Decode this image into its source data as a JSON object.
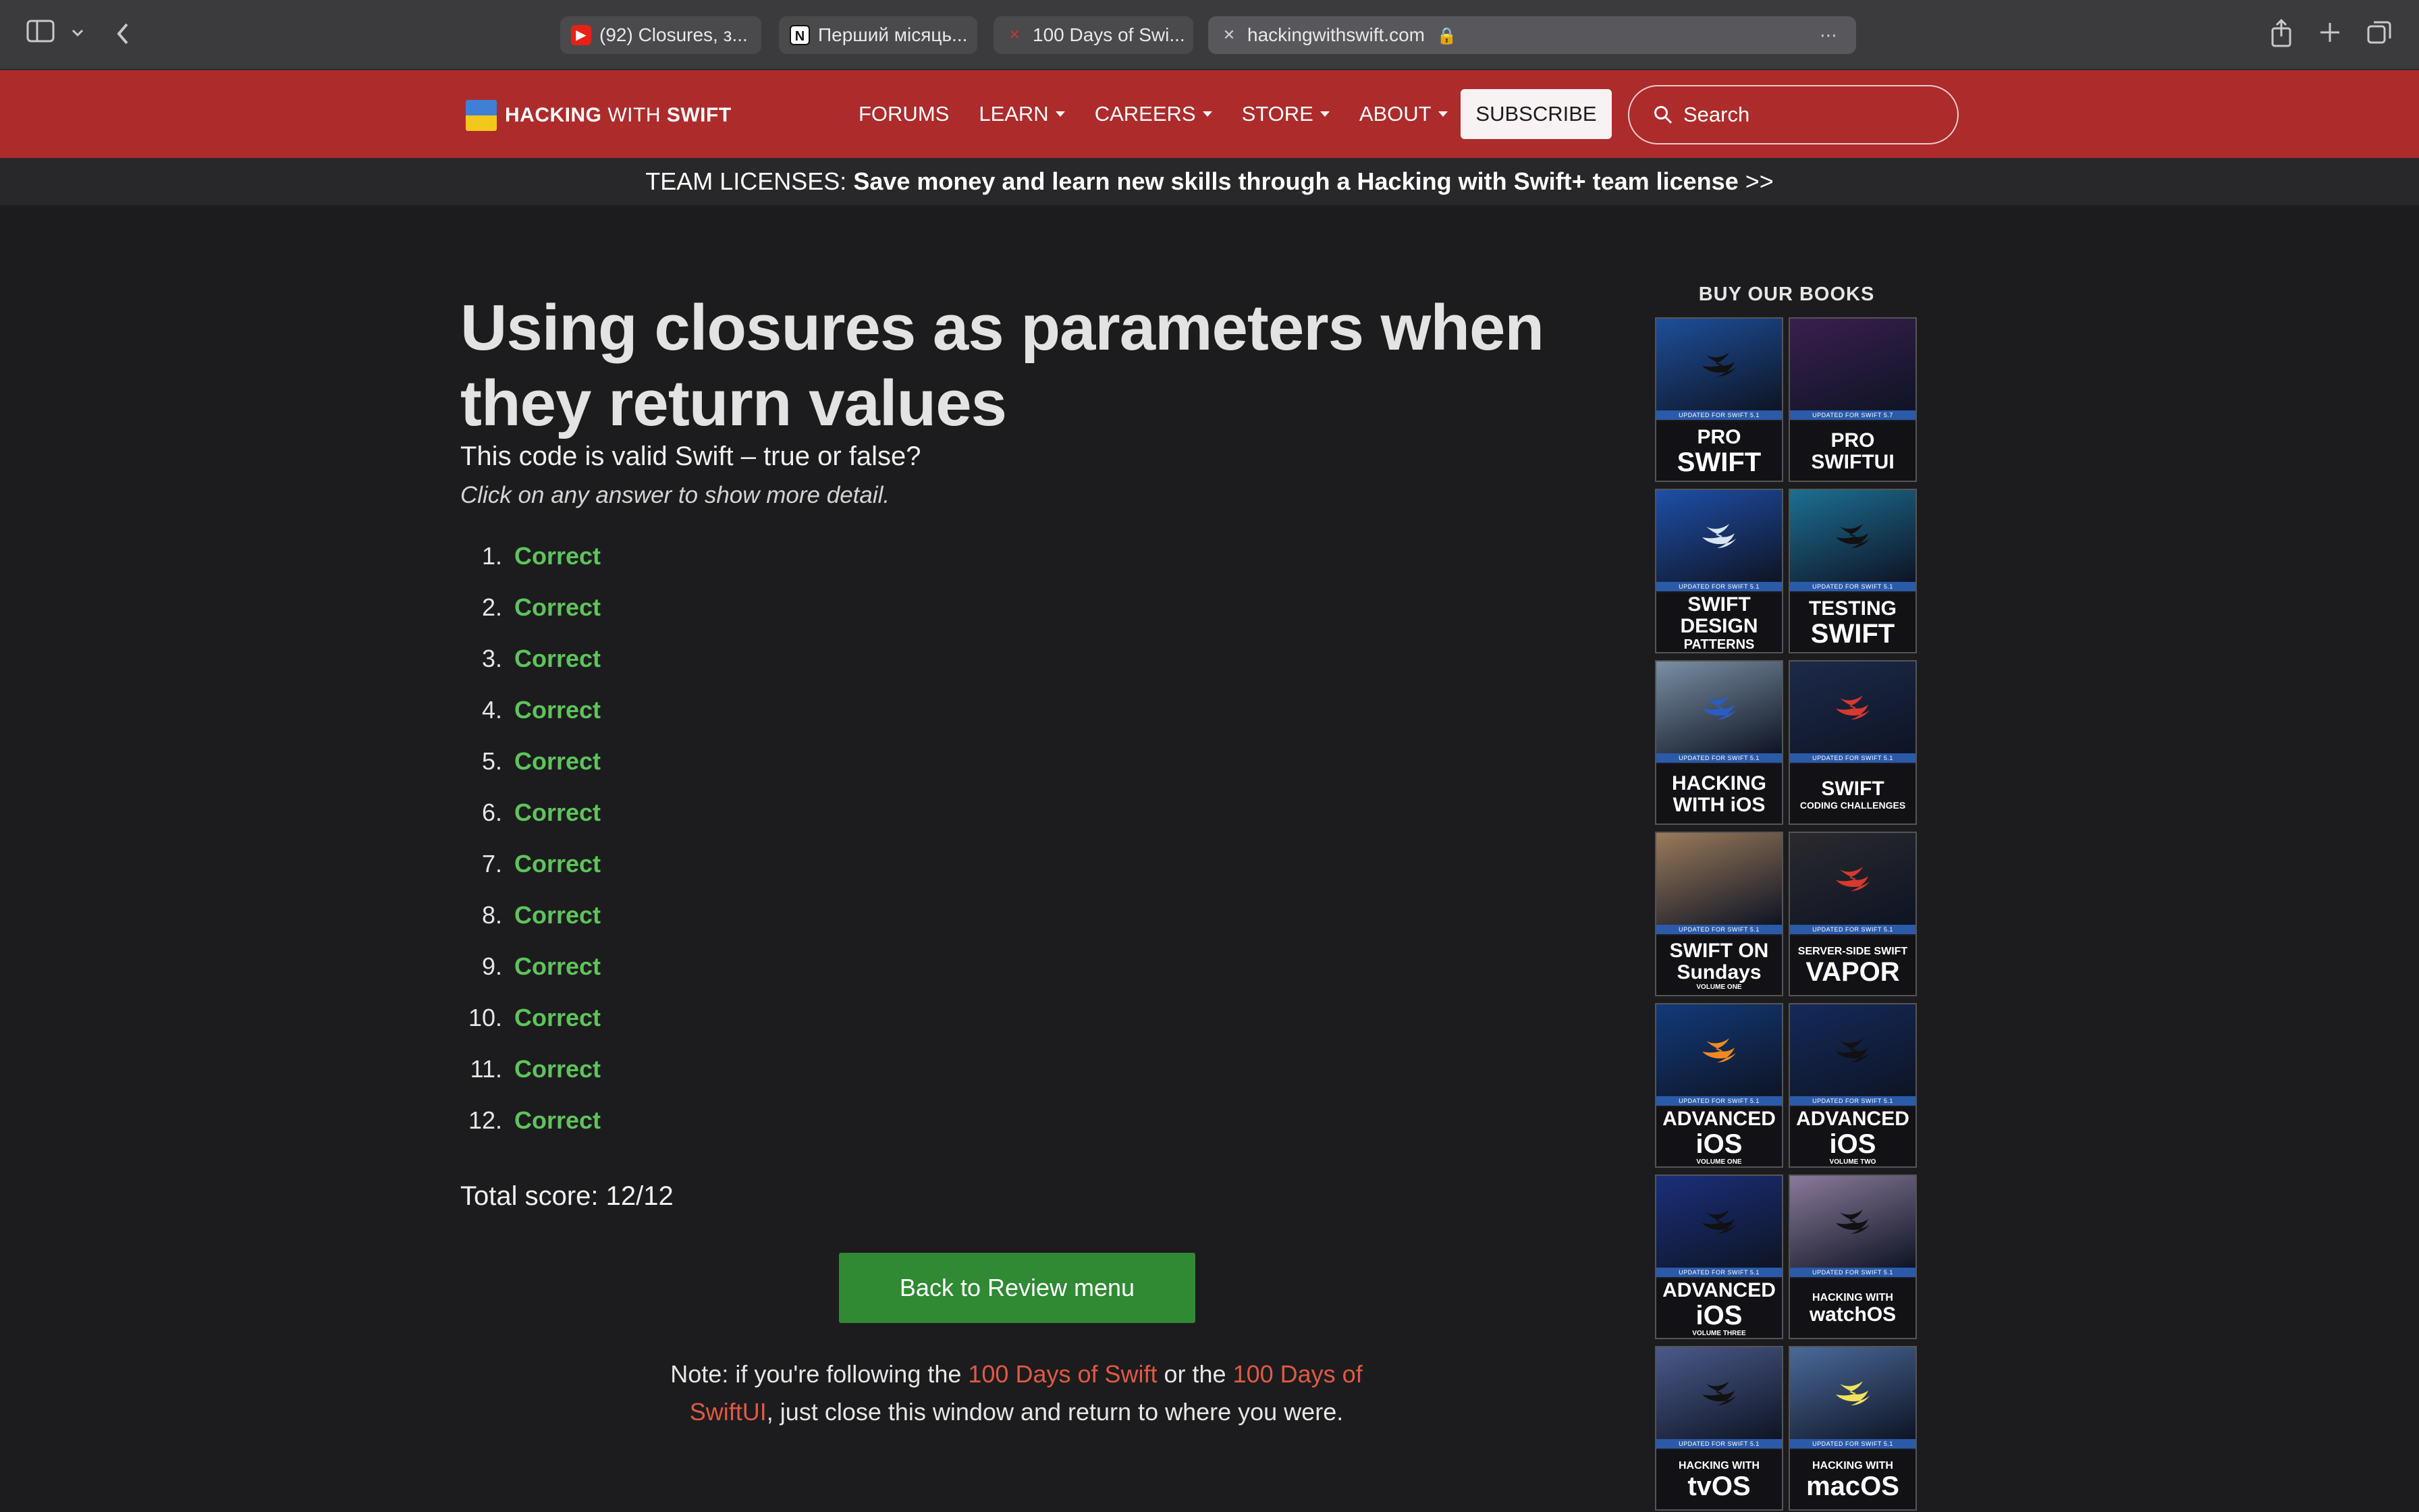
{
  "browser": {
    "tabs": [
      {
        "label": "(92) Closures, з...",
        "favicon": "youtube-icon",
        "color": "#e62117"
      },
      {
        "label": "Перший місяць...",
        "favicon": "notion-icon",
        "color": "#ffffff"
      },
      {
        "label": "100 Days of Swi...",
        "favicon": "swift-icon",
        "color": "#c0392b"
      }
    ],
    "address": "hackingwithswift.com"
  },
  "nav": {
    "logo_bold": "HACKING",
    "logo_with": "WITH",
    "logo_swift": "SWIFT",
    "links": [
      "FORUMS",
      "LEARN",
      "CAREERS",
      "STORE",
      "ABOUT"
    ],
    "subscribe": "SUBSCRIBE",
    "search_placeholder": "Search"
  },
  "banner": {
    "prefix": "TEAM LICENSES:",
    "text": "Save money and learn new skills through a Hacking with Swift+ team license",
    "suffix": ">>"
  },
  "main": {
    "title": "Using closures as parameters when they return values",
    "subtitle": "This code is valid Swift – true or false?",
    "hint": "Click on any answer to show more detail.",
    "answers": [
      {
        "n": "1.",
        "result": "Correct"
      },
      {
        "n": "2.",
        "result": "Correct"
      },
      {
        "n": "3.",
        "result": "Correct"
      },
      {
        "n": "4.",
        "result": "Correct"
      },
      {
        "n": "5.",
        "result": "Correct"
      },
      {
        "n": "6.",
        "result": "Correct"
      },
      {
        "n": "7.",
        "result": "Correct"
      },
      {
        "n": "8.",
        "result": "Correct"
      },
      {
        "n": "9.",
        "result": "Correct"
      },
      {
        "n": "10.",
        "result": "Correct"
      },
      {
        "n": "11.",
        "result": "Correct"
      },
      {
        "n": "12.",
        "result": "Correct"
      }
    ],
    "score": "Total score: 12/12",
    "back_button": "Back to Review menu",
    "note_1": "Note: if you're following the ",
    "note_link1": "100 Days of Swift",
    "note_2": " or the ",
    "note_link2": "100 Days of SwiftUI",
    "note_3": ", just close this window and return to where you were."
  },
  "sidebar": {
    "heading": "BUY OUR BOOKS",
    "books": [
      {
        "line1": "PRO",
        "line2": "SWIFT",
        "strip": "UPDATED FOR SWIFT 5.1",
        "art": "#1d4f9a",
        "bird": "#111"
      },
      {
        "line1": "PRO",
        "line2": "SWIFTUI",
        "strip": "UPDATED FOR SWIFT 5.7",
        "art": "#3a1f4f",
        "bird": "none"
      },
      {
        "line1": "SWIFT",
        "line2": "DESIGN",
        "line3": "PATTERNS",
        "strip": "UPDATED FOR SWIFT 5.1",
        "art": "#1e4fa8",
        "bird": "#d9e4f5"
      },
      {
        "line1": "TESTING",
        "line2": "SWIFT",
        "strip": "UPDATED FOR SWIFT 5.1",
        "art": "#1c6f93",
        "bird": "#111"
      },
      {
        "line1": "HACKING",
        "line2": "WITH iOS",
        "strip": "UPDATED FOR SWIFT 5.1",
        "art": "#7a8fa3",
        "bird": "#2a5dc4"
      },
      {
        "line1": "SWIFT",
        "line2": "CODING CHALLENGES",
        "strip": "UPDATED FOR SWIFT 5.1",
        "art": "#1c2a4a",
        "bird": "#d63a2e"
      },
      {
        "line1": "SWIFT ON",
        "line2": "Sundays",
        "line3": "VOLUME ONE",
        "strip": "UPDATED FOR SWIFT 5.1",
        "art": "#9a7a5a",
        "bird": "none"
      },
      {
        "line1": "SERVER-SIDE SWIFT",
        "line2": "VAPOR",
        "strip": "UPDATED FOR SWIFT 5.1",
        "art": "#2a2a2e",
        "bird": "#d63a2e"
      },
      {
        "line1": "ADVANCED",
        "line2": "iOS",
        "line3": "VOLUME ONE",
        "strip": "UPDATED FOR SWIFT 5.1",
        "art": "#123a7a",
        "bird": "#f08a1e"
      },
      {
        "line1": "ADVANCED",
        "line2": "iOS",
        "line3": "VOLUME TWO",
        "strip": "UPDATED FOR SWIFT 5.1",
        "art": "#142a5a",
        "bird": "#111"
      },
      {
        "line1": "ADVANCED",
        "line2": "iOS",
        "line3": "VOLUME THREE",
        "strip": "UPDATED FOR SWIFT 5.1",
        "art": "#1a2f7a",
        "bird": "#111"
      },
      {
        "line1": "HACKING WITH",
        "line2": "watchOS",
        "strip": "UPDATED FOR SWIFT 5.1",
        "art": "#8a7a9a",
        "bird": "#111"
      },
      {
        "line1": "HACKING WITH",
        "line2": "tvOS",
        "strip": "UPDATED FOR SWIFT 5.1",
        "art": "#4a5a8a",
        "bird": "#111"
      },
      {
        "line1": "HACKING WITH",
        "line2": "macOS",
        "strip": "UPDATED FOR SWIFT 5.1",
        "art": "#4a6a9a",
        "bird": "#f2e25a"
      }
    ]
  },
  "colors": {
    "nav_bg": "#ad2b2b",
    "correct": "#5ec45a",
    "button_bg": "#2f8a33",
    "link": "#e05a44"
  }
}
